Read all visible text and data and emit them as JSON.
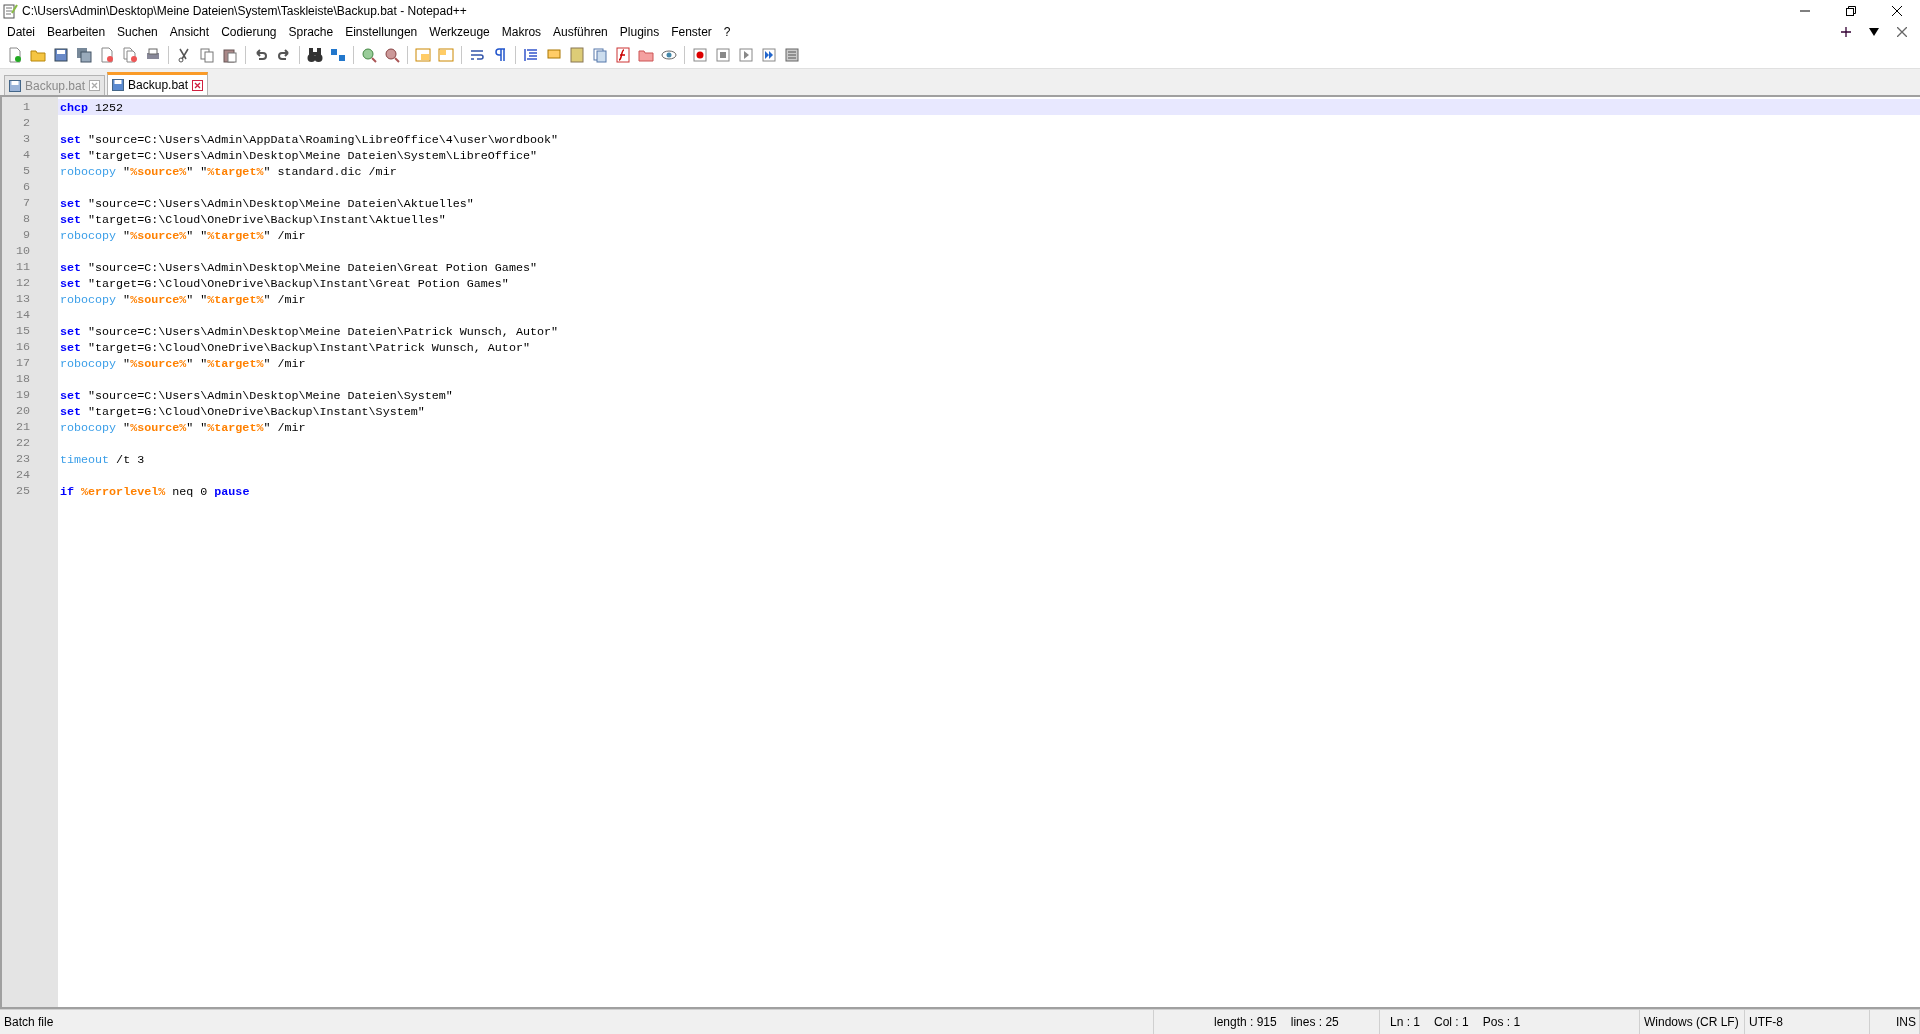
{
  "window": {
    "title": "C:\\Users\\Admin\\Desktop\\Meine Dateien\\System\\Taskleiste\\Backup.bat - Notepad++"
  },
  "menu": [
    "Datei",
    "Bearbeiten",
    "Suchen",
    "Ansicht",
    "Codierung",
    "Sprache",
    "Einstellungen",
    "Werkzeuge",
    "Makros",
    "Ausführen",
    "Plugins",
    "Fenster",
    "?"
  ],
  "tabs": [
    {
      "label": "Backup.bat",
      "selected": false
    },
    {
      "label": "Backup.bat",
      "selected": true
    }
  ],
  "editor": {
    "lines": [
      {
        "number": "1",
        "current": true,
        "tokens": [
          {
            "kind": "keyword",
            "text": "chcp"
          },
          {
            "kind": "text",
            "text": " 1252"
          }
        ]
      },
      {
        "number": "2",
        "current": false
      },
      {
        "number": "3",
        "current": false,
        "tokens": [
          {
            "kind": "keyword",
            "text": "set"
          },
          {
            "kind": "text",
            "text": " \"source=C:\\Users\\Admin\\AppData\\Roaming\\LibreOffice\\4\\user\\wordbook\""
          }
        ]
      },
      {
        "number": "4",
        "current": false,
        "tokens": [
          {
            "kind": "keyword",
            "text": "set"
          },
          {
            "kind": "text",
            "text": " \"target=C:\\Users\\Admin\\Desktop\\Meine Dateien\\System\\LibreOffice\""
          }
        ]
      },
      {
        "number": "5",
        "current": false,
        "tokens": [
          {
            "kind": "command",
            "text": "robocopy"
          },
          {
            "kind": "text",
            "text": " \""
          },
          {
            "kind": "variable",
            "text": "%source%"
          },
          {
            "kind": "text",
            "text": "\" \""
          },
          {
            "kind": "variable",
            "text": "%target%"
          },
          {
            "kind": "text",
            "text": "\" standard.dic /mir"
          }
        ]
      },
      {
        "number": "6",
        "current": false
      },
      {
        "number": "7",
        "current": false,
        "tokens": [
          {
            "kind": "keyword",
            "text": "set"
          },
          {
            "kind": "text",
            "text": " \"source=C:\\Users\\Admin\\Desktop\\Meine Dateien\\Aktuelles\""
          }
        ]
      },
      {
        "number": "8",
        "current": false,
        "tokens": [
          {
            "kind": "keyword",
            "text": "set"
          },
          {
            "kind": "text",
            "text": " \"target=G:\\Cloud\\OneDrive\\Backup\\Instant\\Aktuelles\""
          }
        ]
      },
      {
        "number": "9",
        "current": false,
        "tokens": [
          {
            "kind": "command",
            "text": "robocopy"
          },
          {
            "kind": "text",
            "text": " \""
          },
          {
            "kind": "variable",
            "text": "%source%"
          },
          {
            "kind": "text",
            "text": "\" \""
          },
          {
            "kind": "variable",
            "text": "%target%"
          },
          {
            "kind": "text",
            "text": "\" /mir"
          }
        ]
      },
      {
        "number": "10",
        "current": false
      },
      {
        "number": "11",
        "current": false,
        "tokens": [
          {
            "kind": "keyword",
            "text": "set"
          },
          {
            "kind": "text",
            "text": " \"source=C:\\Users\\Admin\\Desktop\\Meine Dateien\\Great Potion Games\""
          }
        ]
      },
      {
        "number": "12",
        "current": false,
        "tokens": [
          {
            "kind": "keyword",
            "text": "set"
          },
          {
            "kind": "text",
            "text": " \"target=G:\\Cloud\\OneDrive\\Backup\\Instant\\Great Potion Games\""
          }
        ]
      },
      {
        "number": "13",
        "current": false,
        "tokens": [
          {
            "kind": "command",
            "text": "robocopy"
          },
          {
            "kind": "text",
            "text": " \""
          },
          {
            "kind": "variable",
            "text": "%source%"
          },
          {
            "kind": "text",
            "text": "\" \""
          },
          {
            "kind": "variable",
            "text": "%target%"
          },
          {
            "kind": "text",
            "text": "\" /mir"
          }
        ]
      },
      {
        "number": "14",
        "current": false
      },
      {
        "number": "15",
        "current": false,
        "tokens": [
          {
            "kind": "keyword",
            "text": "set"
          },
          {
            "kind": "text",
            "text": " \"source=C:\\Users\\Admin\\Desktop\\Meine Dateien\\Patrick Wunsch, Autor\""
          }
        ]
      },
      {
        "number": "16",
        "current": false,
        "tokens": [
          {
            "kind": "keyword",
            "text": "set"
          },
          {
            "kind": "text",
            "text": " \"target=G:\\Cloud\\OneDrive\\Backup\\Instant\\Patrick Wunsch, Autor\""
          }
        ]
      },
      {
        "number": "17",
        "current": false,
        "tokens": [
          {
            "kind": "command",
            "text": "robocopy"
          },
          {
            "kind": "text",
            "text": " \""
          },
          {
            "kind": "variable",
            "text": "%source%"
          },
          {
            "kind": "text",
            "text": "\" \""
          },
          {
            "kind": "variable",
            "text": "%target%"
          },
          {
            "kind": "text",
            "text": "\" /mir"
          }
        ]
      },
      {
        "number": "18",
        "current": false
      },
      {
        "number": "19",
        "current": false,
        "tokens": [
          {
            "kind": "keyword",
            "text": "set"
          },
          {
            "kind": "text",
            "text": " \"source=C:\\Users\\Admin\\Desktop\\Meine Dateien\\System\""
          }
        ]
      },
      {
        "number": "20",
        "current": false,
        "tokens": [
          {
            "kind": "keyword",
            "text": "set"
          },
          {
            "kind": "text",
            "text": " \"target=G:\\Cloud\\OneDrive\\Backup\\Instant\\System\""
          }
        ]
      },
      {
        "number": "21",
        "current": false,
        "tokens": [
          {
            "kind": "command",
            "text": "robocopy"
          },
          {
            "kind": "text",
            "text": " \""
          },
          {
            "kind": "variable",
            "text": "%source%"
          },
          {
            "kind": "text",
            "text": "\" \""
          },
          {
            "kind": "variable",
            "text": "%target%"
          },
          {
            "kind": "text",
            "text": "\" /mir"
          }
        ]
      },
      {
        "number": "22",
        "current": false
      },
      {
        "number": "23",
        "current": false,
        "tokens": [
          {
            "kind": "command",
            "text": "timeout"
          },
          {
            "kind": "text",
            "text": " /t 3"
          }
        ]
      },
      {
        "number": "24",
        "current": false
      },
      {
        "number": "25",
        "current": false,
        "tokens": [
          {
            "kind": "keyword",
            "text": "if "
          },
          {
            "kind": "variable",
            "text": "%errorlevel%"
          },
          {
            "kind": "text",
            "text": " neq 0 "
          },
          {
            "kind": "keyword",
            "text": "pause"
          }
        ]
      }
    ]
  },
  "status_bar": {
    "language": "Batch file",
    "length": "length : 915",
    "lines": "lines : 25",
    "ln": "Ln : 1",
    "col": "Col : 1",
    "pos": "Pos : 1",
    "eol": "Windows (CR LF)",
    "encoding": "UTF-8",
    "mode": "INS"
  }
}
